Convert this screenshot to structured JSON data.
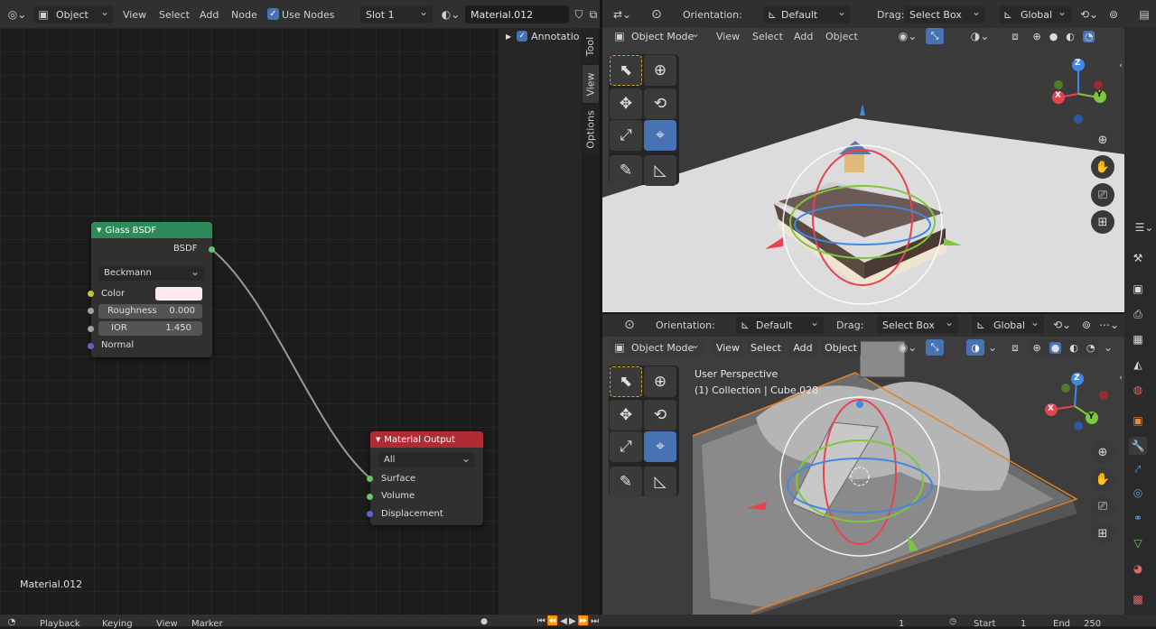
{
  "node_editor": {
    "header": {
      "editor_type_icon": "node-editor-icon",
      "mode": "Object",
      "menus": [
        "View",
        "Select",
        "Add",
        "Node"
      ],
      "use_nodes_label": "Use Nodes",
      "use_nodes_checked": true,
      "slot": "Slot 1",
      "material_name": "Material.012"
    },
    "sidebar_tabs": [
      "Tool",
      "View",
      "Options"
    ],
    "annotations_label": "Annotatio",
    "material_label": "Material.012",
    "glass_node": {
      "title": "Glass BSDF",
      "output_label": "BSDF",
      "distribution": "Beckmann",
      "color_label": "Color",
      "color_value": "#fde8f0",
      "roughness_label": "Roughness",
      "roughness_value": "0.000",
      "ior_label": "IOR",
      "ior_value": "1.450",
      "normal_label": "Normal"
    },
    "output_node": {
      "title": "Material Output",
      "target": "All",
      "surface_label": "Surface",
      "volume_label": "Volume",
      "displacement_label": "Displacement"
    }
  },
  "viewport_top": {
    "orientation_label": "Orientation:",
    "orientation_value": "Default",
    "drag_label": "Drag:",
    "drag_value": "Select Box",
    "transform_space": "Global",
    "mode": "Object Mode",
    "menus": [
      "View",
      "Select",
      "Add",
      "Object"
    ]
  },
  "viewport_bottom": {
    "orientation_label": "Orientation:",
    "orientation_value": "Default",
    "drag_label": "Drag:",
    "drag_value": "Select Box",
    "transform_space": "Global",
    "mode": "Object Mode",
    "menus": [
      "View",
      "Select",
      "Add",
      "Object"
    ],
    "overlay_title": "User Perspective",
    "overlay_collection": "(1) Collection | Cube.028"
  },
  "gizmo": {
    "x": "X",
    "y": "Y",
    "z": "Z"
  },
  "timeline": {
    "menus": [
      "Playback",
      "Keying",
      "View",
      "Marker"
    ],
    "current_frame": "1",
    "start_label": "Start",
    "start_value": "1",
    "end_label": "End",
    "end_value": "250"
  },
  "colors": {
    "shader_header": "#2f8a5a",
    "output_header": "#b02c34",
    "active_blue": "#4772b3",
    "socket_green": "#63c763",
    "socket_yellow": "#c7c729",
    "socket_gray": "#a1a1a1",
    "socket_purple": "#6363c7",
    "axis_x": "#e8424f",
    "axis_y": "#7fc63d",
    "axis_z": "#3f88e6"
  }
}
